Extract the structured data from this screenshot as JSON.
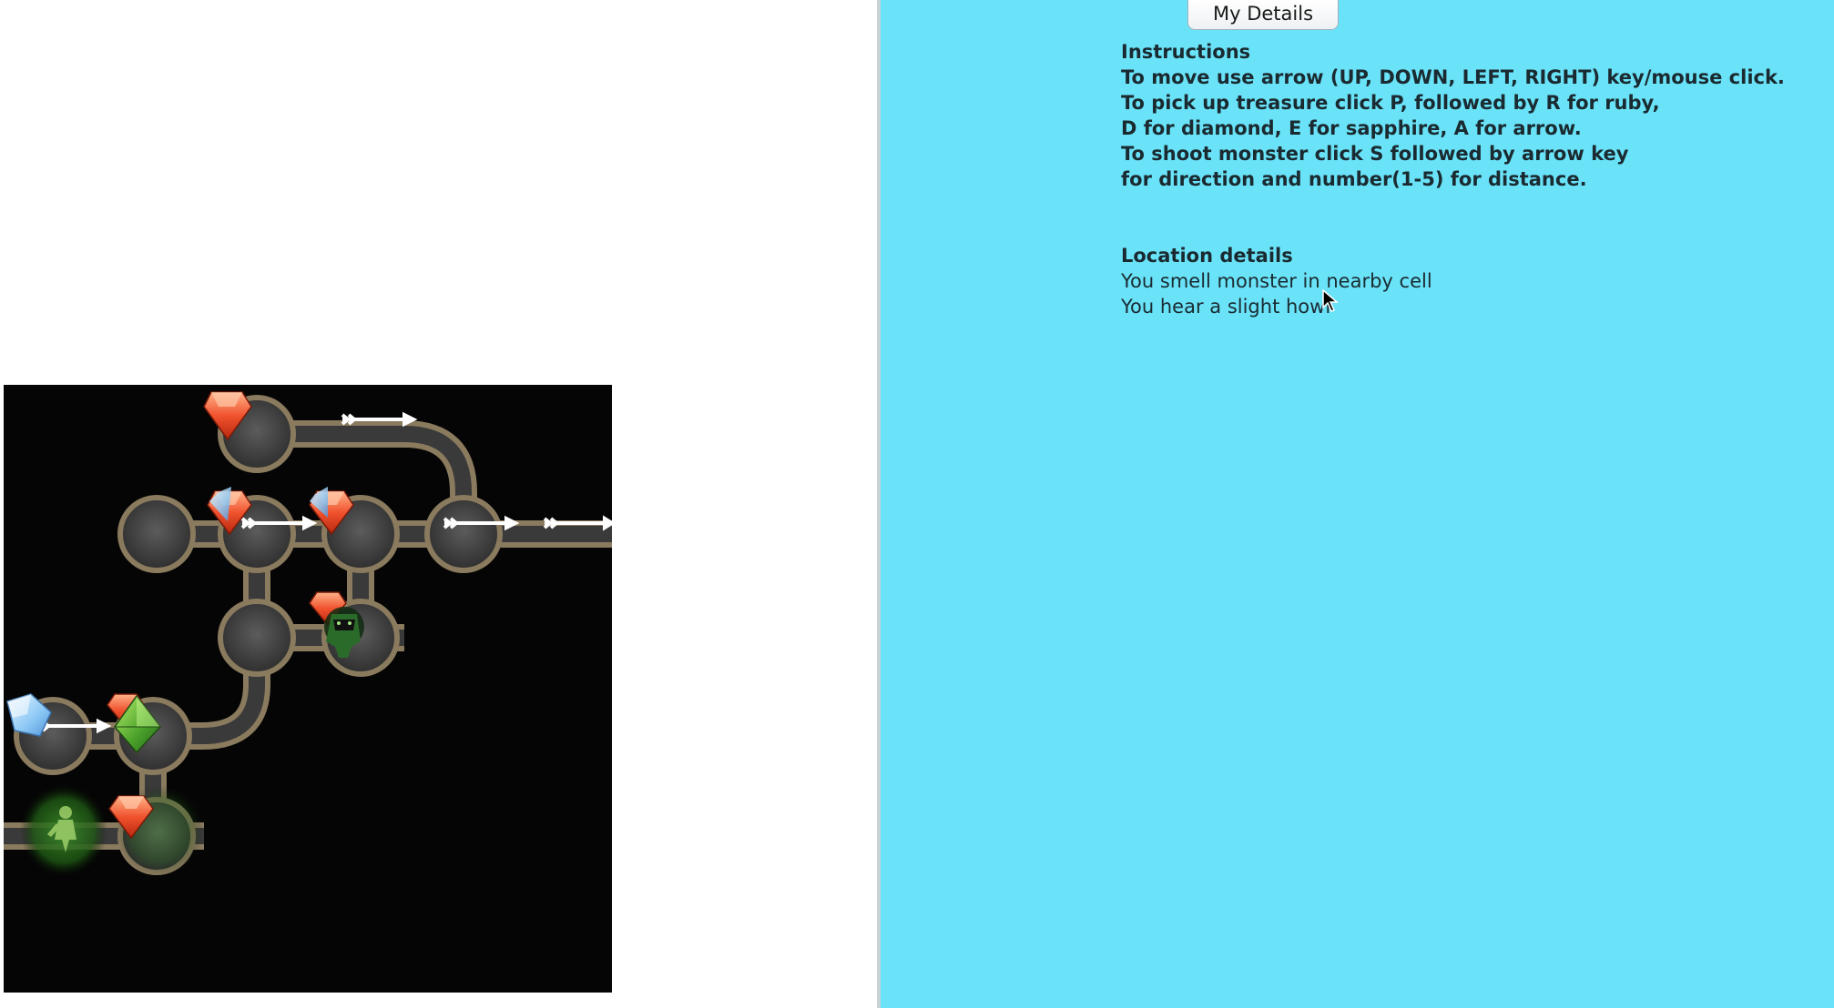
{
  "details_button": {
    "label": "My Details"
  },
  "instructions": {
    "heading": "Instructions",
    "lines": [
      "To move use arrow (UP, DOWN, LEFT, RIGHT) key/mouse click.",
      "To pick up treasure click P, followed by R for ruby,",
      "D for diamond, E for sapphire, A for arrow.",
      "To shoot monster click S followed by arrow key",
      "for direction and number(1-5) for distance."
    ]
  },
  "location": {
    "heading": "Location details",
    "lines": [
      "You smell monster in nearby cell",
      "You hear a slight howl"
    ]
  },
  "colors": {
    "panel_background": "#6ae3f9",
    "board_background": "#050505"
  }
}
